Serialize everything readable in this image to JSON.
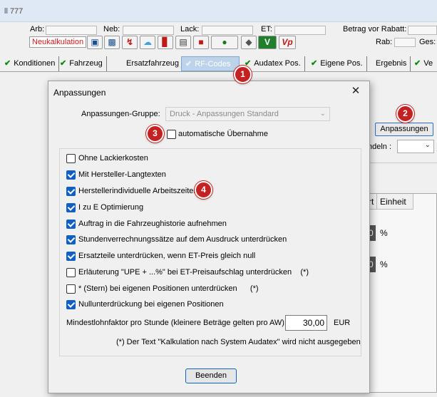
{
  "window": {
    "title_fragment": "ll 777"
  },
  "info": {
    "arb_label": "Arb:",
    "neb_label": "Neb:",
    "lack_label": "Lack:",
    "et_label": "ET:",
    "betrag_label": "Betrag vor Rabatt:",
    "rab_label": "Rab:",
    "ges_label": "Ges:",
    "neukalkulation_label": "Neukalkulation",
    "toolbar_icons": [
      "camera-icon",
      "car-icon",
      "lightning-icon",
      "cloud-icon",
      "bar-chart-icon",
      "document-icon",
      "red-block-icon",
      "car-check-icon",
      "diamond-icon",
      "v-icon",
      "vp-icon"
    ]
  },
  "tabs": [
    {
      "label": "Konditionen",
      "check": true
    },
    {
      "label": "Fahrzeug",
      "check": true
    },
    {
      "label": "Ersatzfahrzeug",
      "check": false
    },
    {
      "label": "RF-Codes",
      "check": true,
      "active": true
    },
    {
      "label": "Audatex Pos.",
      "check": true
    },
    {
      "label": "Eigene Pos.",
      "check": true
    },
    {
      "label": "Ergebnis",
      "check": false
    },
    {
      "label": "Ve",
      "check": true
    }
  ],
  "background": {
    "anpassungen_button": "Anpassungen",
    "runden_label": "ndeln :",
    "grid_header_fragment": "rt",
    "grid_header_einheit": "Einheit",
    "grid_rows": [
      {
        "value_fragment": "0",
        "unit": "%"
      },
      {
        "value_fragment": "0",
        "unit": "%"
      }
    ]
  },
  "markers": [
    "1",
    "2",
    "3",
    "4"
  ],
  "dialog": {
    "title": "Anpassungen",
    "close_label": "✕",
    "gruppe_label": "Anpassungen-Gruppe:",
    "gruppe_value": "Druck - Anpassungen Standard",
    "auto_label": "automatische Übernahme",
    "auto_checked": false,
    "options": [
      {
        "label": "Ohne Lackierkosten",
        "checked": false
      },
      {
        "label": "Mit Hersteller-Langtexten",
        "checked": true
      },
      {
        "label": "Herstellerindividuelle Arbeitszeiten",
        "checked": true
      },
      {
        "label": "I zu E Optimierung",
        "checked": true
      },
      {
        "label": "Auftrag in die Fahrzeughistorie aufnehmen",
        "checked": true
      },
      {
        "label": "Stundenverrechnungssätze auf dem Ausdruck unterdrücken",
        "checked": true
      },
      {
        "label": "Ersatzteile unterdrücken, wenn ET-Preis gleich null",
        "checked": true
      },
      {
        "label": "Erläuterung \"UPE + ...%\" bei ET-Preisaufschlag unterdrücken    (*)",
        "checked": false
      },
      {
        "label": "* (Stern) bei eigenen Positionen unterdrücken      (*)",
        "checked": false
      },
      {
        "label": "Nullunterdrückung bei eigenen Positionen",
        "checked": true
      }
    ],
    "mindestlohn_label": "Mindestlohnfaktor pro Stunde (kleinere Beträge gelten pro AW):",
    "mindestlohn_value": "30,00",
    "mindestlohn_unit": "EUR",
    "note": "(*) Der Text \"Kalkulation nach System Audatex\" wird nicht ausgegeben",
    "beenden_label": "Beenden"
  }
}
